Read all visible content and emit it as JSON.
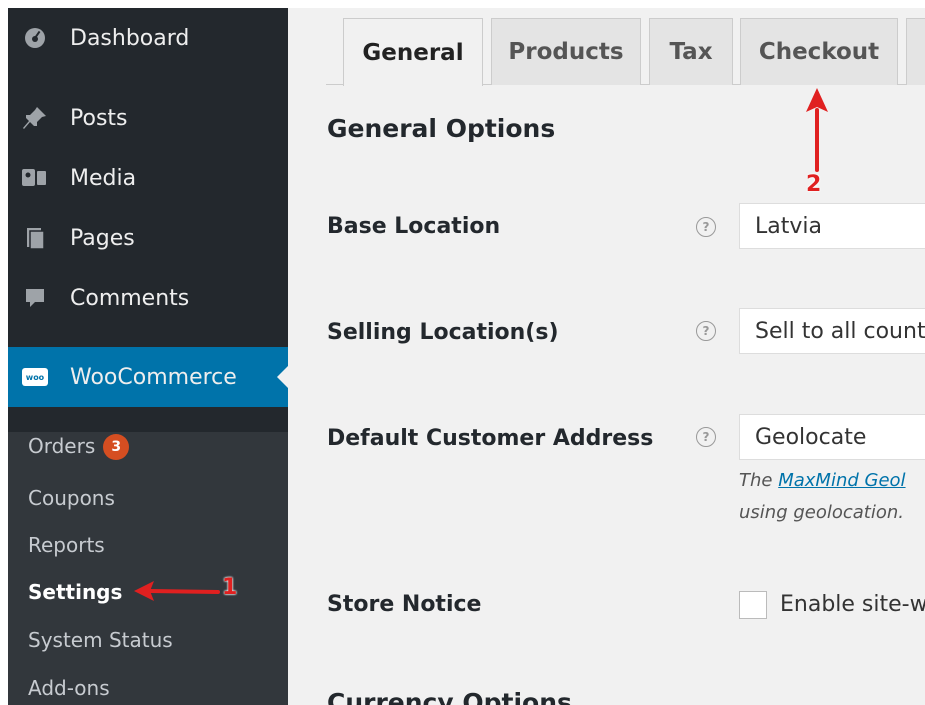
{
  "sidebar": {
    "items": [
      {
        "label": "Dashboard",
        "icon": "dashboard-icon"
      },
      {
        "label": "Posts",
        "icon": "pin-icon"
      },
      {
        "label": "Media",
        "icon": "media-icon"
      },
      {
        "label": "Pages",
        "icon": "pages-icon"
      },
      {
        "label": "Comments",
        "icon": "comment-icon"
      }
    ],
    "woocommerce": {
      "label": "WooCommerce",
      "logo": "woo"
    },
    "submenu": [
      {
        "label": "Orders",
        "badge": "3"
      },
      {
        "label": "Coupons"
      },
      {
        "label": "Reports"
      },
      {
        "label": "Settings"
      },
      {
        "label": "System Status"
      },
      {
        "label": "Add-ons"
      }
    ]
  },
  "tabs": [
    "General",
    "Products",
    "Tax",
    "Checkout"
  ],
  "main": {
    "section_title": "General Options",
    "fields": {
      "base_location": {
        "label": "Base Location",
        "value": "Latvia"
      },
      "selling_locations": {
        "label": "Selling Location(s)",
        "value": "Sell to all count"
      },
      "default_address": {
        "label": "Default Customer Address",
        "value": "Geolocate",
        "desc_pre": "The ",
        "desc_link": "MaxMind Geol",
        "desc_line2": "using geolocation."
      },
      "store_notice": {
        "label": "Store Notice",
        "checkbox_label": "Enable site-w"
      }
    },
    "next_section": "Currency Options"
  },
  "annotations": {
    "arrow1": "1",
    "arrow2": "2",
    "color": "#e02020"
  }
}
